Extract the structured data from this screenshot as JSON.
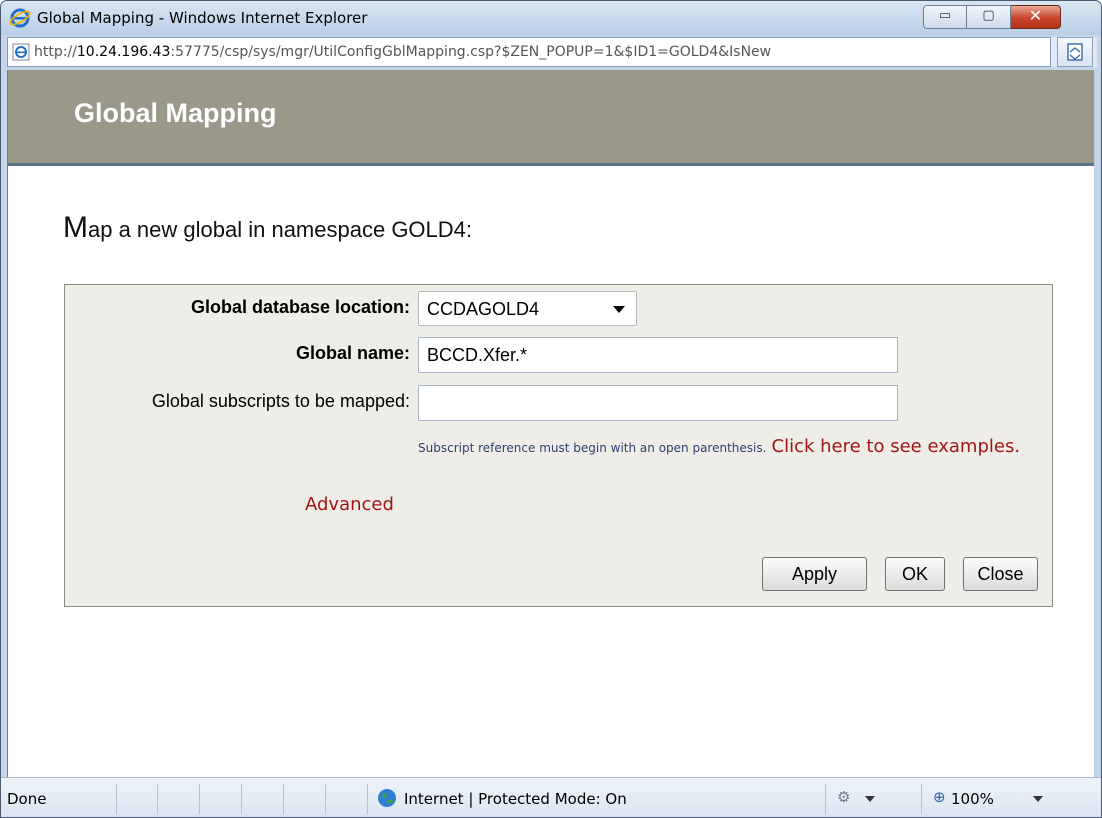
{
  "window": {
    "title": "Global Mapping - Windows Internet Explorer",
    "min_glyph": "▭",
    "max_glyph": "▢",
    "close_glyph": "✕"
  },
  "address_bar": {
    "url_prefix": "http://",
    "url_host": "10.24.196.43",
    "url_rest": ":57775/csp/sys/mgr/UtilConfigGblMapping.csp?$ZEN_POPUP=1&$ID1=GOLD4&IsNew"
  },
  "header": {
    "title": "Global Mapping"
  },
  "intro": {
    "first_letter": "M",
    "rest": "ap a new global in namespace GOLD4:"
  },
  "form": {
    "db_location_label": "Global database location:",
    "db_location_value": "CCDAGOLD4",
    "global_name_label": "Global name:",
    "global_name_value": "BCCD.Xfer.*",
    "subscripts_label": "Global subscripts to be mapped:",
    "subscripts_value": "",
    "hint_text": "Subscript reference must begin with an open parenthesis.",
    "hint_link": "Click here to see examples.",
    "advanced_link": "Advanced"
  },
  "buttons": {
    "apply": "Apply",
    "ok": "OK",
    "close": "Close"
  },
  "status_bar": {
    "status": "Done",
    "zone": "Internet | Protected Mode: On",
    "zoom": "100%"
  },
  "colors": {
    "header_band": "#9a9888",
    "link_red": "#a31515",
    "panel_bg": "#eeede7"
  }
}
